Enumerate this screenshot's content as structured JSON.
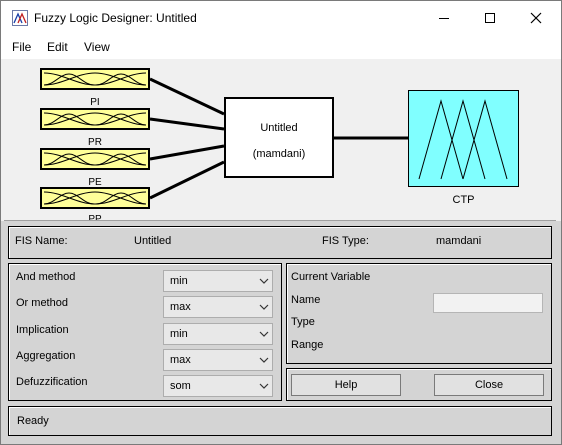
{
  "window": {
    "title": "Fuzzy Logic Designer: Untitled",
    "icon": "matlab-fis-icon",
    "controls": [
      "minimize-icon",
      "maximize-icon",
      "close-icon"
    ]
  },
  "menu": {
    "file": "File",
    "edit": "Edit",
    "view": "View"
  },
  "diagram": {
    "inputs": [
      "PI",
      "PR",
      "PE",
      "PP"
    ],
    "system": {
      "name": "Untitled",
      "type": "(mamdani)"
    },
    "output": "CTP"
  },
  "fis_info": {
    "name_label": "FIS Name:",
    "name_value": "Untitled",
    "type_label": "FIS Type:",
    "type_value": "mamdani"
  },
  "methods": {
    "and": {
      "label": "And method",
      "value": "min"
    },
    "or": {
      "label": "Or method",
      "value": "max"
    },
    "implication": {
      "label": "Implication",
      "value": "min"
    },
    "aggregation": {
      "label": "Aggregation",
      "value": "max"
    },
    "defuzz": {
      "label": "Defuzzification",
      "value": "som"
    }
  },
  "current_variable": {
    "title": "Current Variable",
    "name_label": "Name",
    "name_value": "",
    "type_label": "Type",
    "range_label": "Range"
  },
  "buttons": {
    "help": "Help",
    "close": "Close"
  },
  "status": "Ready",
  "colors": {
    "input_fill": "#ffff99",
    "output_fill": "#80ffff",
    "panel": "#d4d4d4"
  }
}
